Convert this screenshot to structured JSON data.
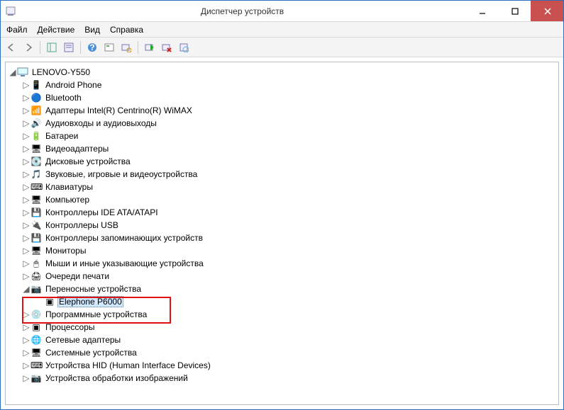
{
  "window": {
    "title": "Диспетчер устройств"
  },
  "menu": {
    "file": "Файл",
    "action": "Действие",
    "view": "Вид",
    "help": "Справка"
  },
  "root": {
    "label": "LENOVO-Y550"
  },
  "nodes": [
    {
      "label": "Android Phone"
    },
    {
      "label": "Bluetooth"
    },
    {
      "label": "Адаптеры Intel(R) Centrino(R) WiMAX"
    },
    {
      "label": "Аудиовходы и аудиовыходы"
    },
    {
      "label": "Батареи"
    },
    {
      "label": "Видеоадаптеры"
    },
    {
      "label": "Дисковые устройства"
    },
    {
      "label": "Звуковые, игровые и видеоустройства"
    },
    {
      "label": "Клавиатуры"
    },
    {
      "label": "Компьютер"
    },
    {
      "label": "Контроллеры IDE ATA/ATAPI"
    },
    {
      "label": "Контроллеры USB"
    },
    {
      "label": "Контроллеры запоминающих устройств"
    },
    {
      "label": "Мониторы"
    },
    {
      "label": "Мыши и иные указывающие устройства"
    },
    {
      "label": "Очереди печати"
    },
    {
      "label": "Переносные устройства",
      "expanded": true,
      "child": "Elephone P6000"
    },
    {
      "label": "Программные устройства"
    },
    {
      "label": "Процессоры"
    },
    {
      "label": "Сетевые адаптеры"
    },
    {
      "label": "Системные устройства"
    },
    {
      "label": "Устройства HID (Human Interface Devices)"
    },
    {
      "label": "Устройства обработки изображений"
    }
  ],
  "icons": [
    "📱",
    "🔵",
    "📶",
    "🔊",
    "🔋",
    "🖥",
    "💽",
    "🎵",
    "⌨",
    "🖥",
    "💾",
    "🔌",
    "💾",
    "🖥",
    "🖱",
    "🖨",
    "📷",
    "💿",
    "▣",
    "🌐",
    "🖥",
    "⌨",
    "📷"
  ]
}
